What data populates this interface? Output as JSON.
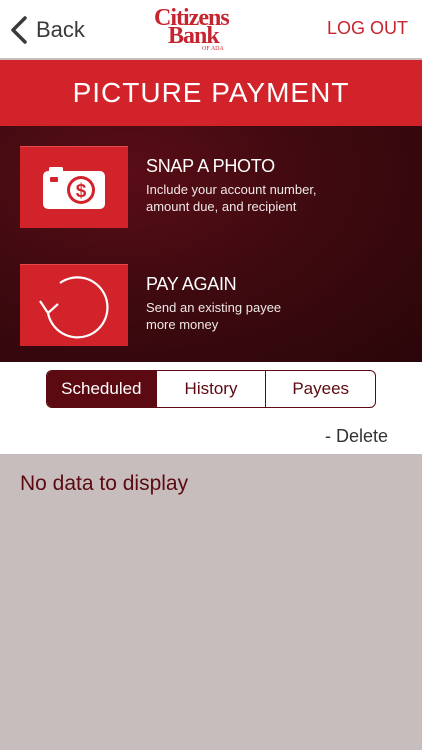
{
  "nav": {
    "back_label": "Back",
    "logo_line1": "Citizens",
    "logo_line2": "Bank",
    "logo_line3": "OF ADA",
    "logout_label": "LOG OUT"
  },
  "title": "PICTURE PAYMENT",
  "actions": [
    {
      "title": "SNAP A PHOTO",
      "subtitle_line1": "Include your account number,",
      "subtitle_line2": "amount due, and recipient",
      "icon": "camera-dollar-icon"
    },
    {
      "title": "PAY AGAIN",
      "subtitle_line1": "Send an existing payee",
      "subtitle_line2": "more money",
      "icon": "repeat-arrow-icon"
    }
  ],
  "tabs": [
    {
      "label": "Scheduled",
      "active": true
    },
    {
      "label": "History",
      "active": false
    },
    {
      "label": "Payees",
      "active": false
    }
  ],
  "delete_label": "- Delete",
  "empty_message": "No data to display",
  "colors": {
    "brand_red": "#d2232a",
    "dark_maroon": "#5c0a12",
    "content_bg": "#c7bdbd"
  }
}
